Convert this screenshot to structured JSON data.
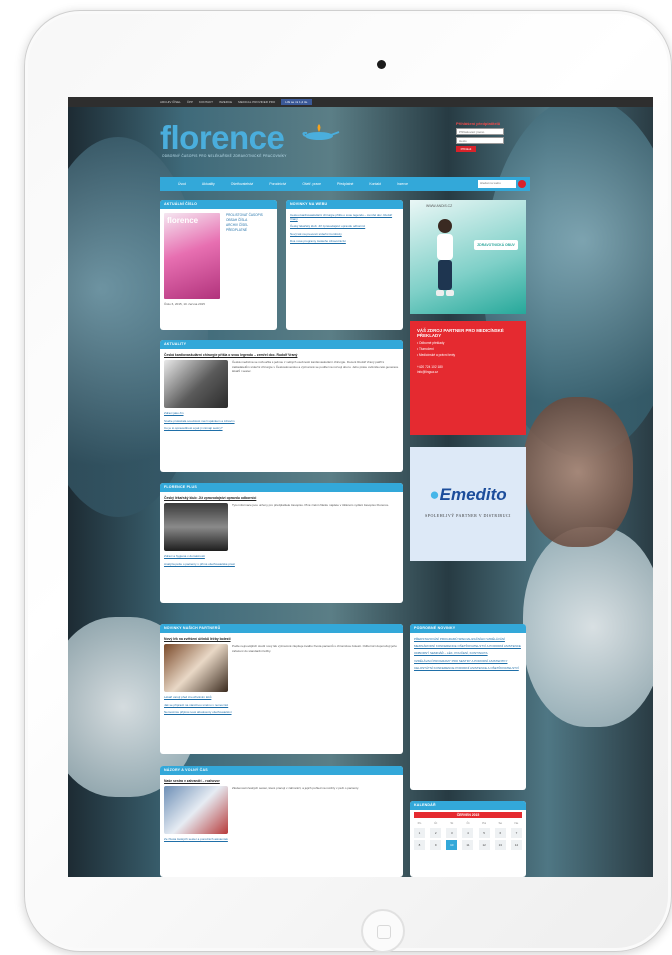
{
  "topbar": {
    "items": [
      "ARCHIV ČÍSEL",
      "ČPP",
      "KONTAKT",
      "INZERCE",
      "MEDICAL PROVIDER PRO"
    ],
    "facebook": "Líbí se mi 1,2 tis."
  },
  "header": {
    "logo": "florence",
    "tagline": "ODBORNÝ ČASOPIS PRO NELÉKAŘSKÉ ZDRAVOTNICKÉ PRACOVNÍKY",
    "login_title": "Přihlášení předplatitelů",
    "login_placeholder": "Přihlašovací jméno",
    "password_placeholder": "Heslo",
    "login_button": "Přihlásit"
  },
  "nav": {
    "items": [
      "Úvod",
      "Aktuality",
      "Ošetřovatelství",
      "Porodnictví",
      "Ošetř. praxe",
      "Předplatné",
      "Kontakt",
      "Inzerce"
    ],
    "search_placeholder": "Hledat na webu"
  },
  "panels": {
    "current_issue": {
      "header": "AKTUÁLNÍ ČÍSLO",
      "magazine_title": "florence",
      "links": [
        "PROLISTOVAT ČASOPIS",
        "OBSAH ČÍSLA",
        "ARCHIV ČÍSEL",
        "PŘEDPLATNÉ"
      ],
      "date": "Číslo 6, 2015, 10. června 2015"
    },
    "web_news": {
      "header": "NOVINKY NA WEBU",
      "links": [
        "Cestou kardiovaskulární chirurgie přišlo o svou legendu – zemřel doc. Rudolf Vraný",
        "Český lékařský klub: Již zpravodajství opravdu odborníci",
        "Nový lék na prevenci srdeční trombózy",
        "Dva nové programy českého zdravotnictví"
      ]
    },
    "news": {
      "header": "AKTUALITY",
      "title": "Česká kardiovaskulární chirurgie přišla o svou legendu – zemřel doc. Rudolf Vraný",
      "text": "Česká medicína se rozloučila s jednou z velkých osobností kardiovaskulární chirurgie. Docent Rudolf Vraný patřil k zakladatelům srdeční chirurgie v Československu a významně se podílel na rozvoji oboru. Jeho práce ovlivnila celé generace lékařů i sester.",
      "links": [
        "Zdraví jako čin",
        "Studie prokázala souvislost mezi spánkem a zdravím",
        "Co je to spravedlnost a jak ji vnímají sestry?"
      ]
    },
    "florence_plus": {
      "header": "FLORENCE PLUS",
      "title": "Český lékařský klub: Již zpravodajství opravdu odborníci",
      "text": "Tyto informace jsou určeny pro předplatitele časopisu. Plné znění článku najdete v tištěném vydání časopisu Florence.",
      "links": [
        "Zdraví a hygiena v domácnosti",
        "Analýza péče o pacienty v přímé ošetřovatelské praxi"
      ]
    },
    "partners": {
      "header": "NOVINKY NAŠICH PARTNERŮ",
      "title": "Nový lék na zvětšení účinků léčby bolesti",
      "text": "Podle nejnovějších studií nový lék významně zlepšuje kvalitu života pacientů s chronickou bolestí. Odborníci doporučují jeho zařazení do standardní léčby.",
      "links": [
        "Lékaři varují před zneužíváním léků",
        "Jak se připravit na náročnou směnu v nemocnici",
        "Nemocnice přijímá nové absolventy ošetřovatelství"
      ]
    },
    "opinions": {
      "header": "NÁZORY A VOLNÝ ČAS",
      "title": "Naše sestra v zahraničí – rozhovor",
      "text": "Zkušenosti českých sester, které pracují v zahraničí, a jejich pohled na rozdíly v péči o pacienty.",
      "links": [
        "Ze života českých sester a porodních asistentek"
      ]
    },
    "education": {
      "header": "PODROBNÉ NOVINKY",
      "links": [
        "PŘEDSTAVOVÁNÍ PROGRAMŮ SPECIALIZAČNÍHO VZDĚLÁVÁNÍ",
        "MEZINÁRODNÍ KONFERENCE OŠETŘOVATELSTVÍ A PORODNÍ ASISTENCE",
        "ODBORNÝ SEMINÁŘ – LÉK, POUČENÍ, KONTINUITA",
        "VZDĚLÁVACÍ PROGRAMY PRO SESTRY A PORODNÍ ASISTENTKY",
        "CELOSTÁTNÍ KONFERENCE PORODNÍ ASISTENCE A OŠETŘOVATELSTVÍ"
      ]
    },
    "calendar": {
      "header": "KALENDÁŘ",
      "month": "ČERVEN 2015",
      "weekdays": [
        "Po",
        "Út",
        "St",
        "Čt",
        "Pá",
        "So",
        "Ne"
      ],
      "week1": [
        "1",
        "2",
        "3",
        "4",
        "5",
        "6",
        "7"
      ],
      "week2": [
        "8",
        "9",
        "10",
        "11",
        "12",
        "13",
        "14"
      ]
    }
  },
  "ads": {
    "partner_label": "WWW.ANDIS.CZ",
    "partner_slogan": "ZDRAVOTNICKÁ OBUV",
    "translation_title": "VÁŠ ZDROJ PARTNER PRO MEDICÍNSKÉ PŘEKLADY",
    "translation_points": [
      "• Odborné překlady",
      "• Tlumočení",
      "• Medicínské a právní texty"
    ],
    "translation_contacts": [
      "+420 724 102 180",
      "info@lingua.cz"
    ],
    "emedito_name": "Emedito",
    "emedito_tagline": "SPOLEHLIVÝ PARTNER V DISTRIBUCI"
  }
}
